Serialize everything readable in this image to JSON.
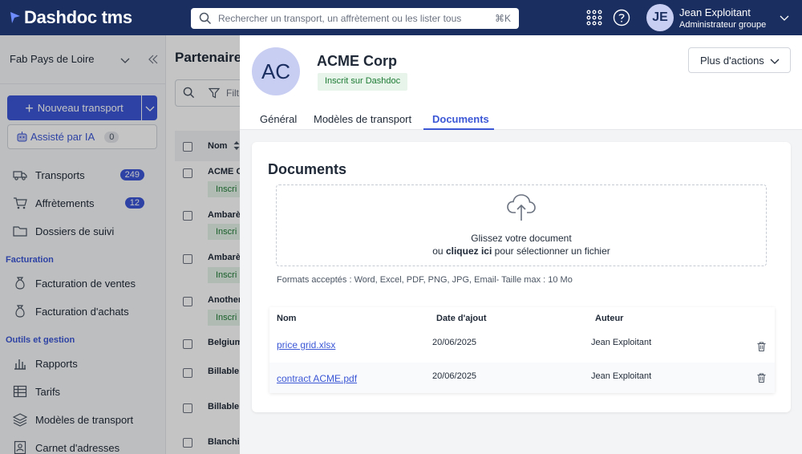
{
  "app": {
    "name": "Dashdoc tms"
  },
  "search": {
    "placeholder": "Rechercher un transport, un affrètement ou les lister tous",
    "shortcut": "⌘K"
  },
  "user": {
    "initials": "JE",
    "name": "Jean Exploitant",
    "role": "Administrateur groupe"
  },
  "sidebar": {
    "organization": "Fab Pays de Loire",
    "new_transport_label": "Nouveau transport",
    "ai_label": "Assisté par IA",
    "ai_count": "0",
    "items": [
      {
        "label": "Transports",
        "icon": "truck-icon",
        "badge": "249"
      },
      {
        "label": "Affrètements",
        "icon": "cart-icon",
        "badge": "12"
      },
      {
        "label": "Dossiers de suivi",
        "icon": "folder-icon"
      }
    ],
    "sections": [
      {
        "title": "Facturation",
        "items": [
          {
            "label": "Facturation de ventes",
            "icon": "money-bag-icon"
          },
          {
            "label": "Facturation d'achats",
            "icon": "money-bag-icon"
          }
        ]
      },
      {
        "title": "Outils et gestion",
        "items": [
          {
            "label": "Rapports",
            "icon": "bar-chart-icon"
          },
          {
            "label": "Tarifs",
            "icon": "table-icon"
          },
          {
            "label": "Modèles de transport",
            "icon": "layers-icon"
          },
          {
            "label": "Carnet d'adresses",
            "icon": "address-book-icon"
          }
        ]
      }
    ]
  },
  "background_page": {
    "title": "Partenaire",
    "filter_label": "Filt",
    "column_name": "Nom",
    "rows": [
      {
        "name": "ACME C",
        "badge": "Inscri"
      },
      {
        "name": "Ambarè",
        "badge": "Inscri"
      },
      {
        "name": "Ambarè",
        "badge": "Inscri"
      },
      {
        "name": "Another",
        "badge": "Inscri"
      },
      {
        "name": "Belgium"
      },
      {
        "name": "Billable"
      },
      {
        "name": "Billable"
      },
      {
        "name": "Blanchi"
      }
    ]
  },
  "drawer": {
    "initials": "AC",
    "company_name": "ACME Corp",
    "status_badge": "Inscrit sur Dashdoc",
    "actions_label": "Plus d'actions",
    "tabs": [
      {
        "label": "Général",
        "active": false
      },
      {
        "label": "Modèles de transport",
        "active": false
      },
      {
        "label": "Documents",
        "active": true
      }
    ],
    "documents": {
      "title": "Documents",
      "dropzone_line1": "Glissez votre document",
      "dropzone_or": "ou",
      "dropzone_click": "cliquez ici",
      "dropzone_rest": "pour sélectionner un fichier",
      "formats": "Formats acceptés : Word, Excel, PDF, PNG, JPG, Email- Taille max : 10 Mo",
      "columns": {
        "name": "Nom",
        "date": "Date d'ajout",
        "author": "Auteur"
      },
      "rows": [
        {
          "name": "price grid.xlsx",
          "date": "20/06/2025",
          "author": "Jean Exploitant"
        },
        {
          "name": "contract ACME.pdf",
          "date": "20/06/2025",
          "author": "Jean Exploitant"
        }
      ]
    }
  },
  "colors": {
    "navy": "#1a2e5f",
    "accent": "#3b57d6",
    "success_bg": "#e6f4ea",
    "success_text": "#1e7b34"
  }
}
